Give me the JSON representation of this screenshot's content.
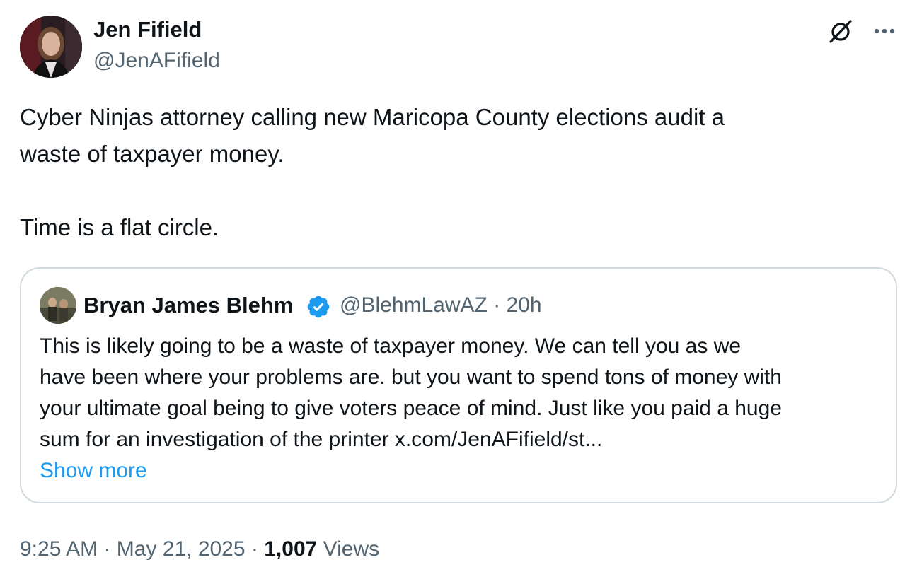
{
  "author": {
    "name": "Jen Fifield",
    "handle": "@JenAFifield"
  },
  "header_icons": {
    "grok": "grok-icon",
    "more": "more-icon"
  },
  "tweet": {
    "lines": [
      "Cyber Ninjas attorney calling new Maricopa County elections audit a",
      "waste of taxpayer money."
    ],
    "second_paragraph": "Time is a flat circle."
  },
  "quote": {
    "name": "Bryan James Blehm",
    "verified_color": "#1d9bf0",
    "handle": "@BlehmLawAZ",
    "separator": "·",
    "time": "20h",
    "lines": [
      "This is likely going to be a waste of taxpayer money.  We can tell you as we",
      "have been where your problems are. but you want to spend tons of money with",
      "your ultimate goal being to give voters peace of mind. Just like you paid a huge",
      "sum for an investigation of the printer x.com/JenAFifield/st..."
    ],
    "show_more": "Show more"
  },
  "footer": {
    "time": "9:25 AM",
    "sep1": "·",
    "date": "May 21, 2025",
    "sep2": "·",
    "views_count": "1,007",
    "views_label": "Views"
  },
  "colors": {
    "text": "#0f1419",
    "secondary": "#536471",
    "link": "#1d9bf0",
    "border": "#cfd9de"
  }
}
